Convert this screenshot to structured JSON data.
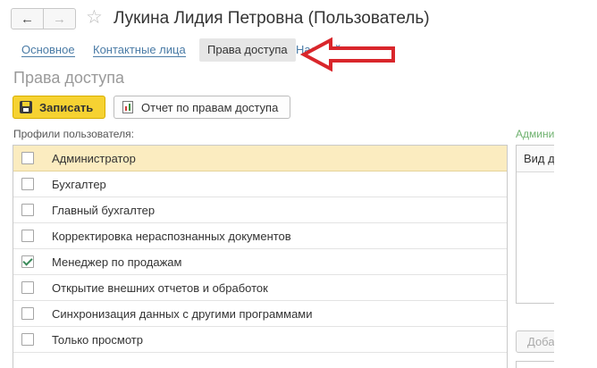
{
  "header": {
    "back_icon": "←",
    "forward_icon": "→",
    "star_icon": "☆",
    "title": "Лукина Лидия Петровна (Пользователь)"
  },
  "tabs": [
    {
      "label": "Основное"
    },
    {
      "label": "Контактные лица"
    },
    {
      "label": "Права доступа"
    },
    {
      "label": "Настройки"
    }
  ],
  "page": {
    "section_title": "Права доступа"
  },
  "toolbar": {
    "save_label": "Записать",
    "report_label": "Отчет по правам доступа"
  },
  "profiles": {
    "label": "Профили пользователя:",
    "items": [
      {
        "label": "Администратор",
        "checked": false
      },
      {
        "label": "Бухгалтер",
        "checked": false
      },
      {
        "label": "Главный бухгалтер",
        "checked": false
      },
      {
        "label": "Корректировка нераспознанных документов",
        "checked": false
      },
      {
        "label": "Менеджер по продажам",
        "checked": true
      },
      {
        "label": "Открытие внешних отчетов и обработок",
        "checked": false
      },
      {
        "label": "Синхронизация данных с другими программами",
        "checked": false
      },
      {
        "label": "Только просмотр",
        "checked": false
      }
    ]
  },
  "right_panel": {
    "label": "Админи",
    "column_header": "Вид д",
    "button_label": "Доба"
  },
  "colors": {
    "accent_yellow": "#f6d232",
    "link_blue": "#4a7ba6",
    "selected_row": "#fbecc0",
    "arrow_red": "#d9262b",
    "check_green": "#3b8a5a"
  }
}
